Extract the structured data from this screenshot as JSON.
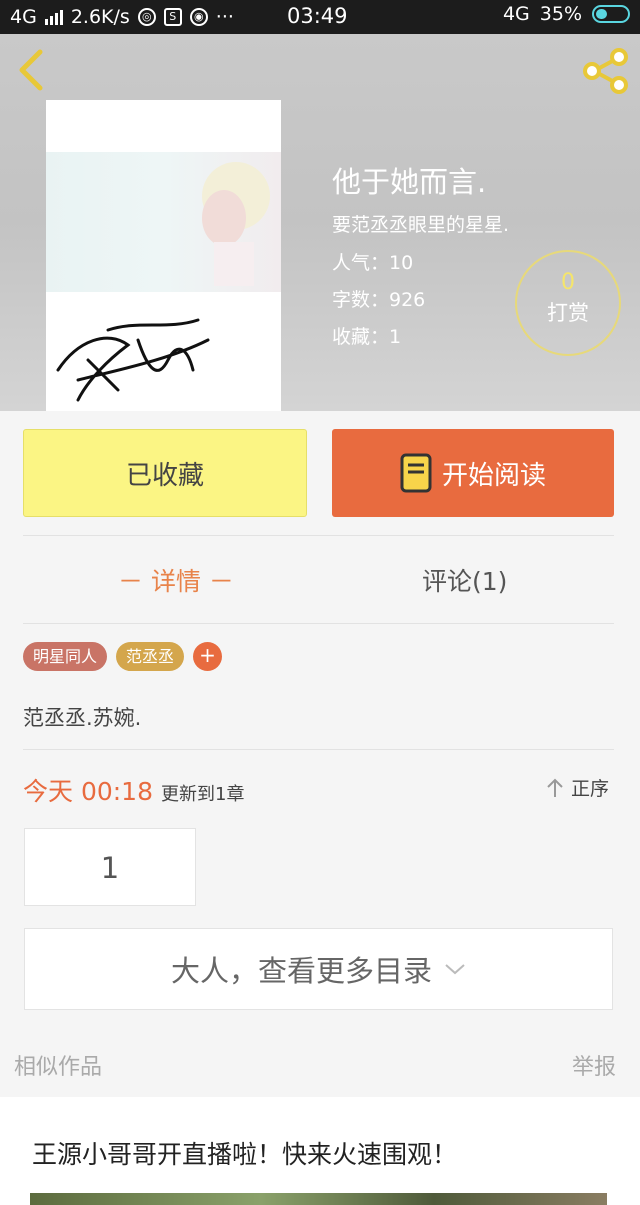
{
  "status_bar": {
    "network": "4G",
    "speed": "2.6K/s",
    "dots": "···",
    "time": "03:49",
    "network_right": "4G",
    "battery": "35%"
  },
  "book": {
    "title": "他于她而言.",
    "subtitle": "要范丞丞眼里的星星.",
    "popularity": "人气：10",
    "word_count": "字数：926",
    "favorites": "收藏：1",
    "tip_count": "0",
    "tip_label": "打赏"
  },
  "actions": {
    "favorited_label": "已收藏",
    "read_label": "开始阅读"
  },
  "tabs": {
    "detail": "－ 详情 －",
    "comment": "评论(1)"
  },
  "tags": [
    "明星同人",
    "范丞丞"
  ],
  "tag_add": "+",
  "description": "范丞丞.苏婉.",
  "update": {
    "when": "今天 00:18",
    "text": "更新到1章",
    "sort_label": "正序"
  },
  "chapters": [
    "1"
  ],
  "more_catalog": "大人，查看更多目录",
  "similar": {
    "label": "相似作品",
    "report": "举报"
  },
  "promo": {
    "title": "王源小哥哥开直播啦！快来火速围观！"
  },
  "colors": {
    "accent_orange": "#e86b3f",
    "fav_yellow": "#fbf584",
    "tag_rose": "#c97466",
    "tag_gold": "#d4a64c"
  }
}
